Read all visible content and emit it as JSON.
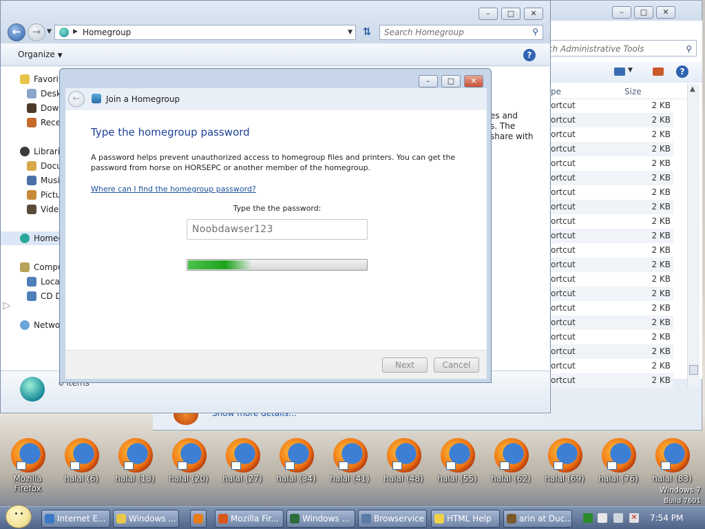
{
  "back_window": {
    "search_placeholder": "rch Administrative Tools",
    "column_type": "pe",
    "column_size": "Size",
    "rows": [
      {
        "type": "ortcut",
        "size": "2 KB"
      },
      {
        "type": "ortcut",
        "size": "2 KB"
      },
      {
        "type": "ortcut",
        "size": "2 KB"
      },
      {
        "type": "ortcut",
        "size": "2 KB"
      },
      {
        "type": "ortcut",
        "size": "2 KB"
      },
      {
        "type": "ortcut",
        "size": "2 KB"
      },
      {
        "type": "ortcut",
        "size": "2 KB"
      },
      {
        "type": "ortcut",
        "size": "2 KB"
      },
      {
        "type": "ortcut",
        "size": "2 KB"
      },
      {
        "type": "ortcut",
        "size": "2 KB"
      },
      {
        "type": "ortcut",
        "size": "2 KB"
      },
      {
        "type": "ortcut",
        "size": "2 KB"
      },
      {
        "type": "ortcut",
        "size": "2 KB"
      },
      {
        "type": "ortcut",
        "size": "2 KB"
      },
      {
        "type": "ortcut",
        "size": "2 KB"
      },
      {
        "type": "ortcut",
        "size": "2 KB"
      },
      {
        "type": "ortcut",
        "size": "2 KB"
      },
      {
        "type": "ortcut",
        "size": "2 KB"
      },
      {
        "type": "ortcut",
        "size": "2 KB"
      },
      {
        "type": "ortcut",
        "size": "2 KB"
      }
    ],
    "details_link": "Show more details..."
  },
  "explorer": {
    "address": "Homegroup",
    "search_placeholder": "Search Homegroup",
    "organize": "Organize",
    "nav": {
      "favorites": "Favorit",
      "desktop": "Deskt",
      "downloads": "Down",
      "recent": "Recer",
      "libraries": "Librarie",
      "documents": "Docu",
      "music": "Musi",
      "pictures": "Pictu",
      "videos": "Video",
      "homegroup": "Homeg",
      "computer": "Compu",
      "local_disk": "Local",
      "cd_drive": "CD D",
      "network": "Netwo"
    },
    "content_text": [
      "es and",
      "s. The",
      "share with"
    ],
    "details_items": "0 items"
  },
  "dialog": {
    "title": "Join a Homegroup",
    "heading": "Type the homegroup password",
    "description": "A password helps prevent unauthorized access to homegroup files and printers. You can get the password from horse on HORSEPC or another member of the homegroup.",
    "help_link": "Where can I find the homegroup password?",
    "password_label": "Type the the password:",
    "password_value": "Noobdawser123",
    "progress": 0.35,
    "next": "Next",
    "cancel": "Cancel"
  },
  "desktop": {
    "icons": [
      "Mozilla Firefox",
      "halal (6)",
      "halal (13)",
      "halal (20)",
      "halal (27)",
      "halal (34)",
      "halal (41)",
      "halal (48)",
      "halal (55)",
      "halal (62)",
      "halal (69)",
      "halal (76)",
      "halal (83)"
    ],
    "windows_label": "Windows 7",
    "build_label": "Build 7601"
  },
  "taskbar": {
    "items": [
      "Internet E...",
      "Windows ...",
      "",
      "Mozilla Fir...",
      "Windows ...",
      "Browservice",
      "HTML Help",
      "arin at Duc..."
    ],
    "clock": "7:54 PM"
  }
}
